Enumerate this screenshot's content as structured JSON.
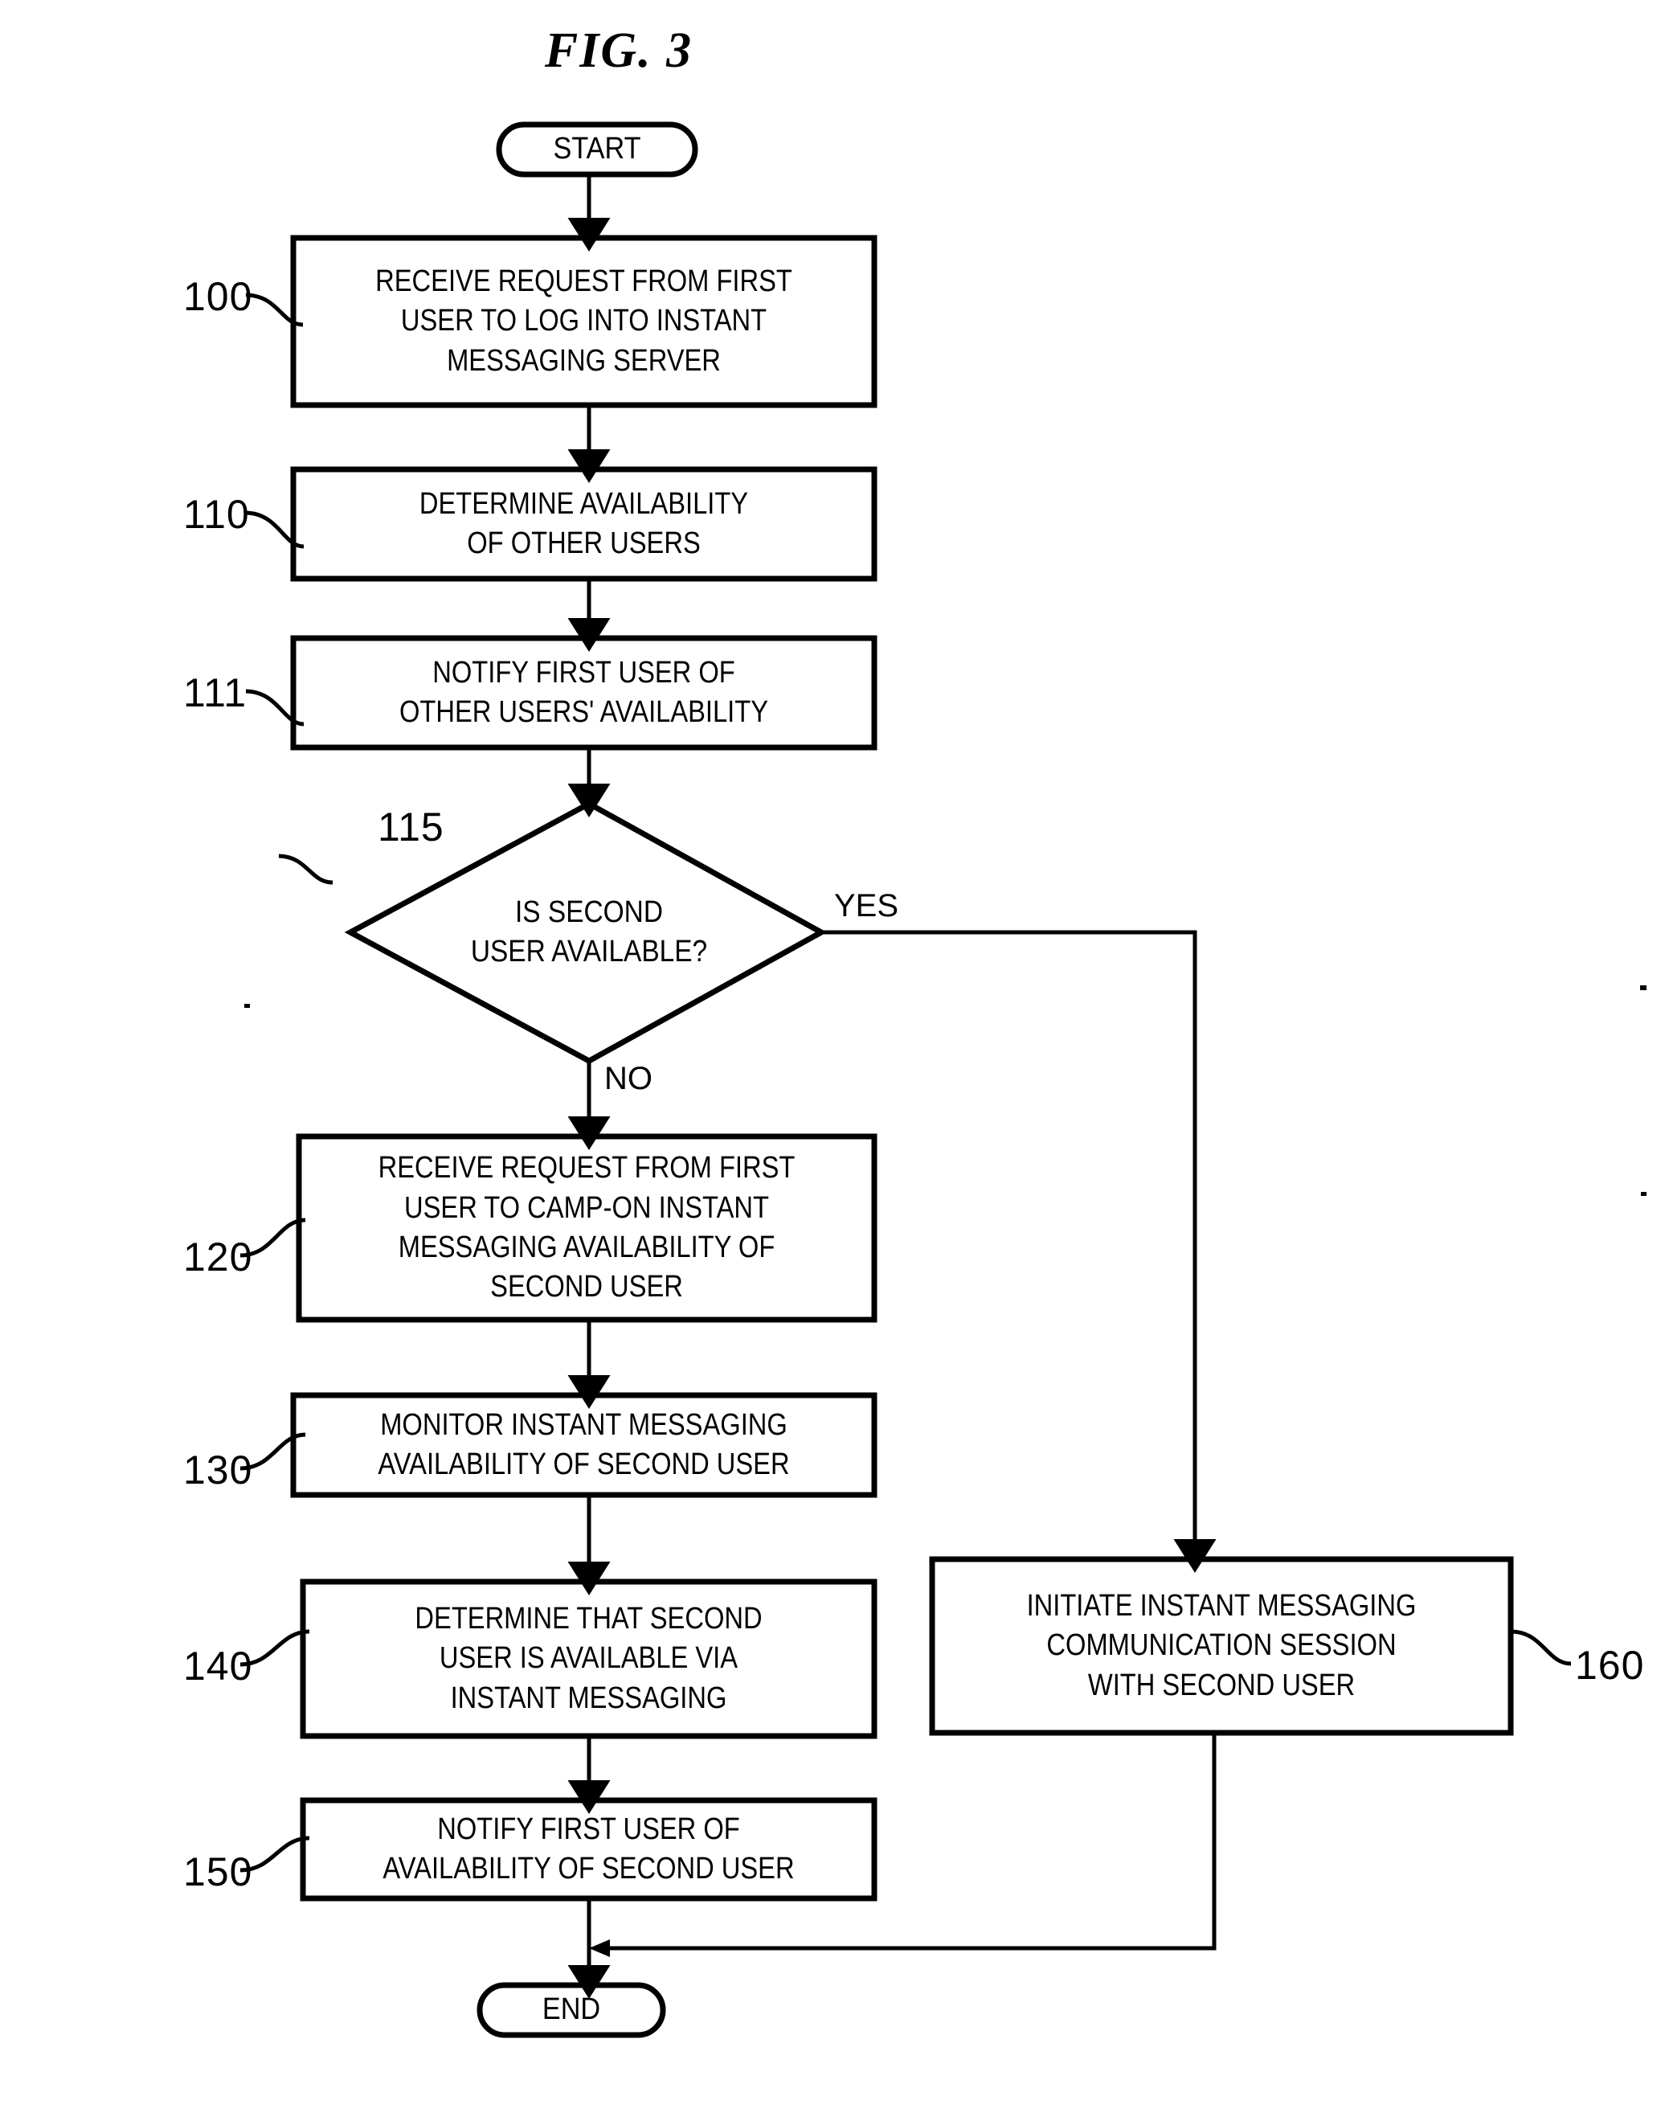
{
  "figure": {
    "title": "FIG. 3",
    "ink_color": "#000000",
    "background_color": "#ffffff"
  },
  "nodes": {
    "start": {
      "ref": "",
      "shape": "terminal",
      "lines": [
        "START"
      ]
    },
    "step100": {
      "ref": "100",
      "shape": "process",
      "lines": [
        "RECEIVE REQUEST FROM FIRST",
        "USER TO LOG INTO INSTANT",
        "MESSAGING SERVER"
      ]
    },
    "step110": {
      "ref": "110",
      "shape": "process",
      "lines": [
        "DETERMINE AVAILABILITY",
        "OF OTHER USERS"
      ]
    },
    "step111": {
      "ref": "111",
      "shape": "process",
      "lines": [
        "NOTIFY FIRST USER OF",
        "OTHER USERS' AVAILABILITY"
      ]
    },
    "decision115": {
      "ref": "115",
      "shape": "decision",
      "lines": [
        "IS SECOND",
        "USER AVAILABLE?"
      ]
    },
    "step120": {
      "ref": "120",
      "shape": "process",
      "lines": [
        "RECEIVE REQUEST FROM FIRST",
        "USER TO CAMP-ON INSTANT",
        "MESSAGING AVAILABILITY OF",
        "SECOND USER"
      ]
    },
    "step130": {
      "ref": "130",
      "shape": "process",
      "lines": [
        "MONITOR INSTANT MESSAGING",
        "AVAILABILITY OF SECOND USER"
      ]
    },
    "step140": {
      "ref": "140",
      "shape": "process",
      "lines": [
        "DETERMINE THAT SECOND",
        "USER IS AVAILABLE VIA",
        "INSTANT MESSAGING"
      ]
    },
    "step150": {
      "ref": "150",
      "shape": "process",
      "lines": [
        "NOTIFY FIRST USER OF",
        "AVAILABILITY OF SECOND USER"
      ]
    },
    "step160": {
      "ref": "160",
      "shape": "process",
      "lines": [
        "INITIATE INSTANT MESSAGING",
        "COMMUNICATION SESSION",
        "WITH SECOND USER"
      ]
    },
    "end": {
      "ref": "",
      "shape": "terminal",
      "lines": [
        "END"
      ]
    }
  },
  "edge_labels": {
    "yes": "YES",
    "no": "NO"
  },
  "flow": [
    {
      "from": "start",
      "to": "step100",
      "label": ""
    },
    {
      "from": "step100",
      "to": "step110",
      "label": ""
    },
    {
      "from": "step110",
      "to": "step111",
      "label": ""
    },
    {
      "from": "step111",
      "to": "decision115",
      "label": ""
    },
    {
      "from": "decision115",
      "to": "step120",
      "label": "NO"
    },
    {
      "from": "decision115",
      "to": "step160",
      "label": "YES"
    },
    {
      "from": "step120",
      "to": "step130",
      "label": ""
    },
    {
      "from": "step130",
      "to": "step140",
      "label": ""
    },
    {
      "from": "step140",
      "to": "step150",
      "label": ""
    },
    {
      "from": "step150",
      "to": "end",
      "label": ""
    },
    {
      "from": "step160",
      "to": "end",
      "label": ""
    }
  ]
}
